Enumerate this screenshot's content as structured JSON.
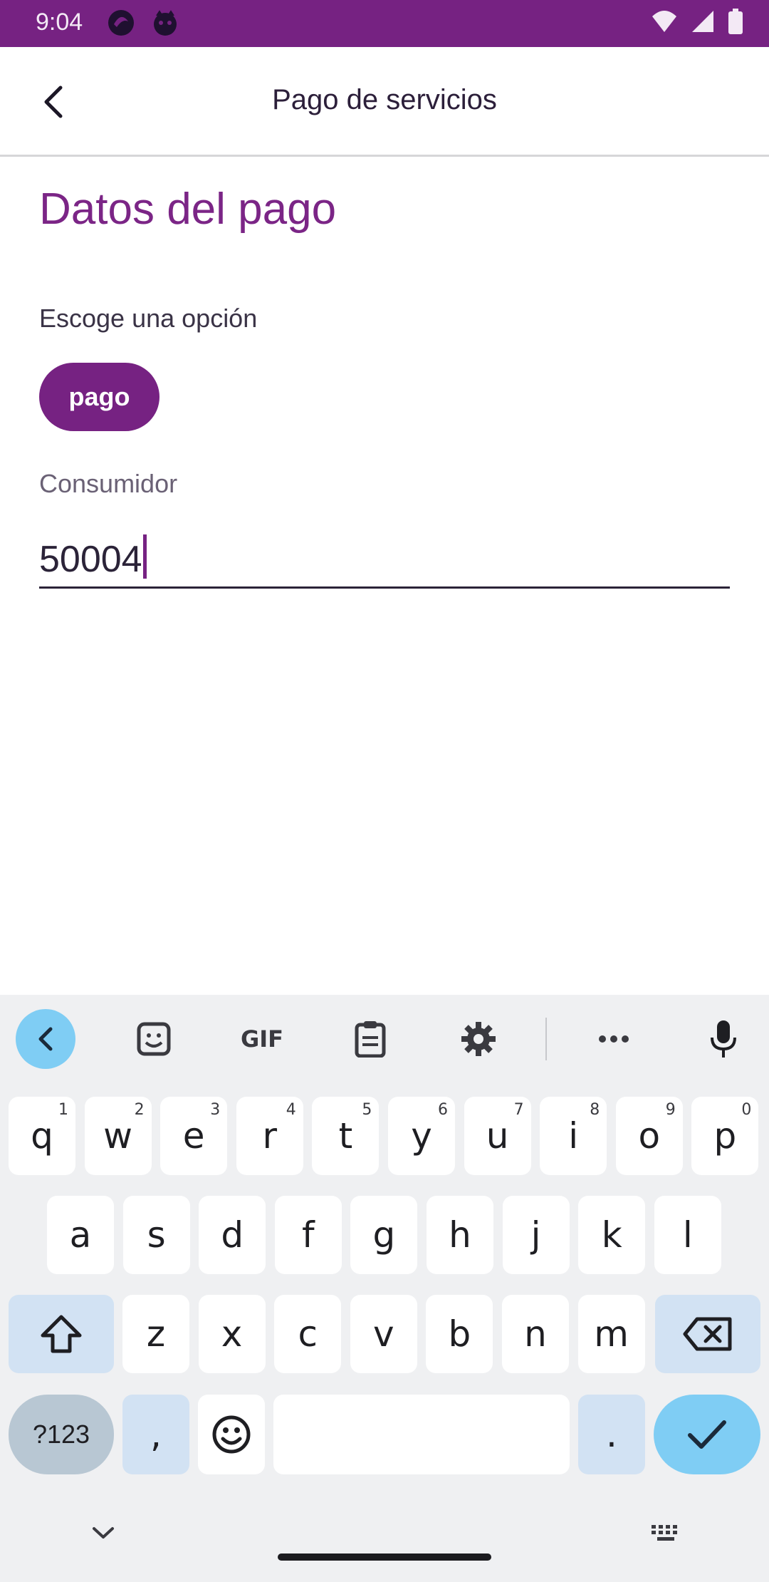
{
  "status_bar": {
    "time": "9:04",
    "background": "#762282"
  },
  "header": {
    "title": "Pago de servicios"
  },
  "main": {
    "section_title": "Datos del pago",
    "option_label": "Escoge una opción",
    "chip_label": "pago",
    "consumer_field": {
      "label": "Consumidor",
      "value": "50004"
    }
  },
  "keyboard": {
    "toolbar": [
      "back-arrow-icon",
      "sticker-icon",
      "GIF",
      "clipboard-icon",
      "gear-icon",
      "more-icon",
      "microphone-icon"
    ],
    "row1": [
      {
        "key": "q",
        "hint": "1"
      },
      {
        "key": "w",
        "hint": "2"
      },
      {
        "key": "e",
        "hint": "3"
      },
      {
        "key": "r",
        "hint": "4"
      },
      {
        "key": "t",
        "hint": "5"
      },
      {
        "key": "y",
        "hint": "6"
      },
      {
        "key": "u",
        "hint": "7"
      },
      {
        "key": "i",
        "hint": "8"
      },
      {
        "key": "o",
        "hint": "9"
      },
      {
        "key": "p",
        "hint": "0"
      }
    ],
    "row2": [
      "a",
      "s",
      "d",
      "f",
      "g",
      "h",
      "j",
      "k",
      "l"
    ],
    "row3": [
      "z",
      "x",
      "c",
      "v",
      "b",
      "n",
      "m"
    ],
    "row4": {
      "symbols": "?123",
      "comma": ",",
      "period": "."
    },
    "accent_color": "#7fcdf4"
  },
  "colors": {
    "brand": "#762282",
    "title": "#7b2586"
  }
}
